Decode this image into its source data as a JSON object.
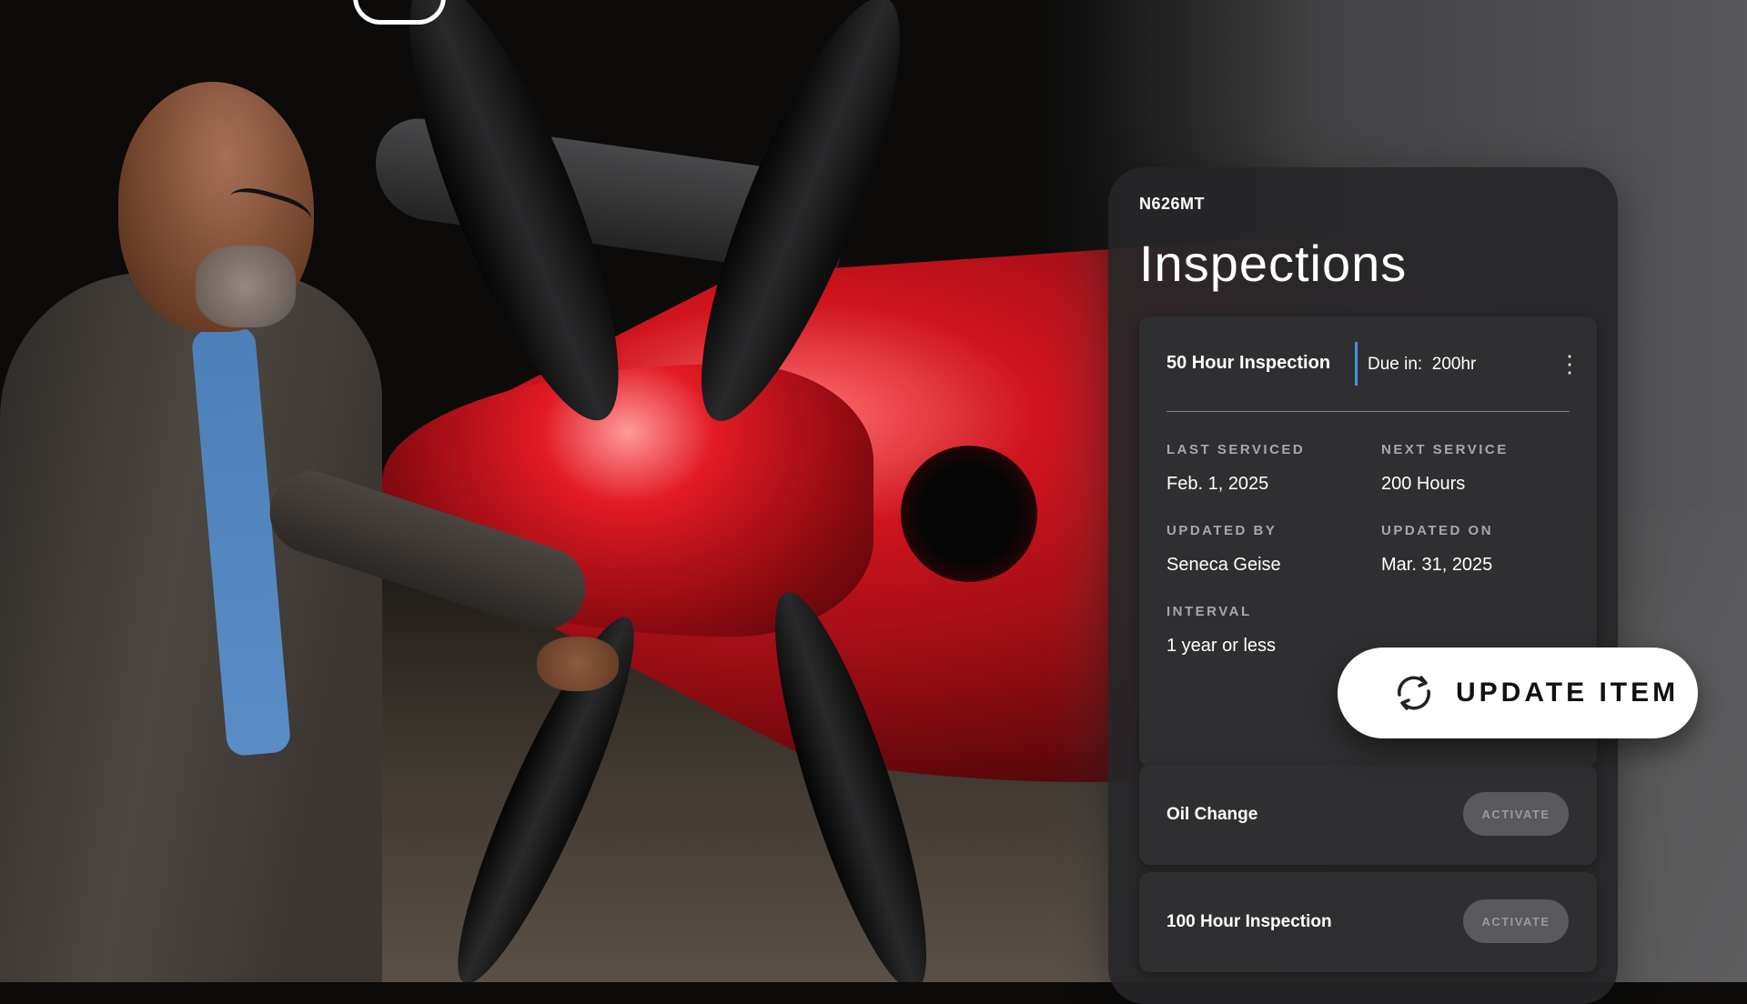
{
  "card": {
    "tail_number": "N626MT",
    "title": "Inspections"
  },
  "active_item": {
    "name": "50 Hour Inspection",
    "due_label": "Due in:",
    "due_value": "200hr",
    "fields": {
      "last_serviced": {
        "label": "LAST SERVICED",
        "value": "Feb. 1, 2025"
      },
      "next_service": {
        "label": "NEXT SERVICE",
        "value": "200 Hours"
      },
      "updated_by": {
        "label": "UPDATED BY",
        "value": "Seneca Geise"
      },
      "updated_on": {
        "label": "UPDATED ON",
        "value": "Mar. 31, 2025"
      },
      "interval": {
        "label": "INTERVAL",
        "value": "1 year or less"
      }
    }
  },
  "items": [
    {
      "name": "Oil Change",
      "action": "ACTIVATE"
    },
    {
      "name": "100 Hour Inspection",
      "action": "ACTIVATE"
    }
  ],
  "update_button": {
    "label": "UPDATE ITEM",
    "icon": "refresh-icon"
  },
  "colors": {
    "accent_blue": "#4a90e2",
    "card_bg": "#262628",
    "aircraft_red": "#d0141e"
  }
}
